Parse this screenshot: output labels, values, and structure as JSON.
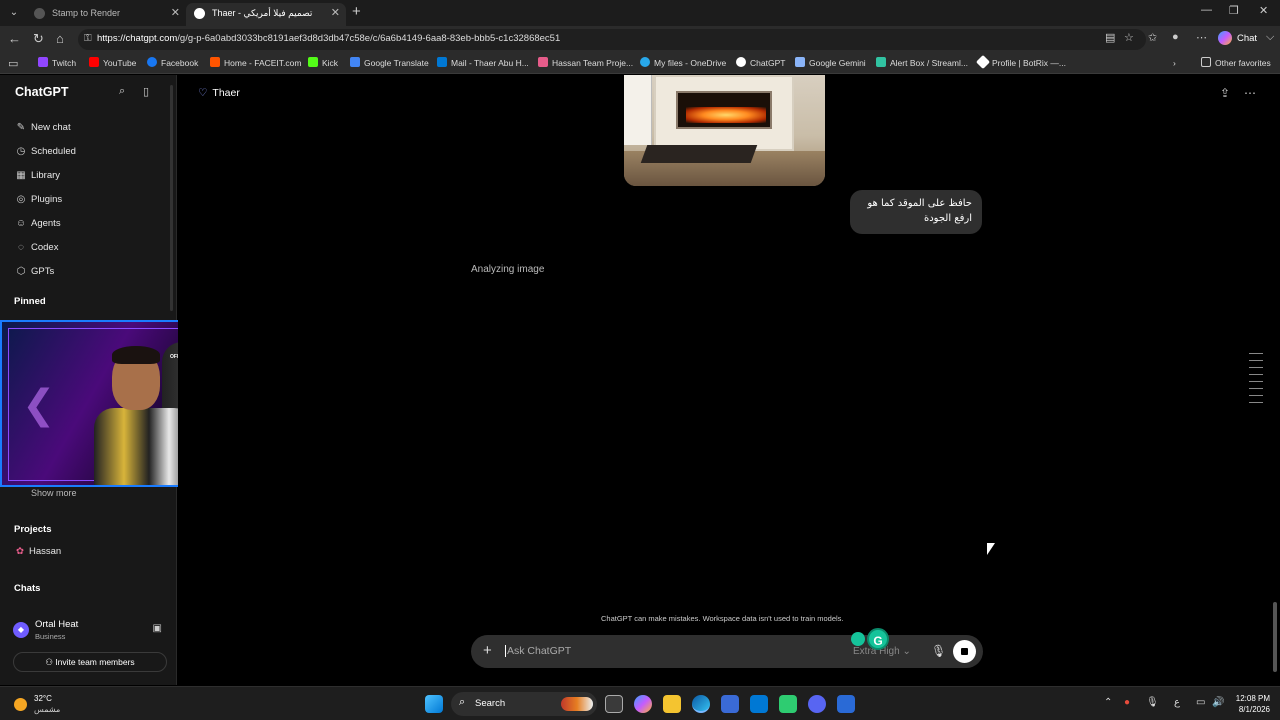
{
  "browser": {
    "tabs": [
      {
        "title": "Stamp to Render",
        "active": false
      },
      {
        "title": "Thaer - تصميم فيلا أمريكي",
        "active": true
      }
    ],
    "url_host": "https://chatgpt.com",
    "url_path": "/g/g-p-6a0abd3033bc8191aef3d8d3db47c58e/c/6a6b4149-6aa8-83eb-bbb5-c1c32868ec51",
    "copilot_label": "Chat",
    "bookmarks": [
      "Twitch",
      "YouTube",
      "Facebook",
      "Home - FACEIT.com",
      "Kick",
      "Google Translate",
      "Mail - Thaer Abu H...",
      "Hassan Team Proje...",
      "My files - OneDrive",
      "ChatGPT",
      "Google Gemini",
      "Alert Box / Streaml...",
      "Profile | BotRix —..."
    ],
    "other_favorites": "Other favorites"
  },
  "sidebar": {
    "brand": "ChatGPT",
    "nav": [
      "New chat",
      "Scheduled",
      "Library",
      "Plugins",
      "Agents",
      "Codex",
      "GPTs"
    ],
    "pinned_title": "Pinned",
    "show_more": "Show more",
    "projects_title": "Projects",
    "project_name": "Hassan",
    "chats_title": "Chats",
    "account_name": "Ortal Heat",
    "account_plan": "Business",
    "invite_label": "Invite team members"
  },
  "webcam": {
    "badge": "OFFICE"
  },
  "main": {
    "gpt_name": "Thaer",
    "user_message_line1": "حافظ على الموقد كما هو",
    "user_message_line2": "ارفع الجودة",
    "status": "Analyzing image",
    "disclaimer": "ChatGPT can make mistakes. Workspace data isn't used to train models.",
    "composer_placeholder": "Ask ChatGPT",
    "model_label": "Extra High"
  },
  "taskbar": {
    "temperature": "32°C",
    "condition": "مشمس",
    "search_label": "Search",
    "lang": "ع",
    "time": "12:08 PM",
    "date": "8/1/2026"
  },
  "colors": {
    "accent": "#1a7cff",
    "grammarly": "#15c39a"
  }
}
